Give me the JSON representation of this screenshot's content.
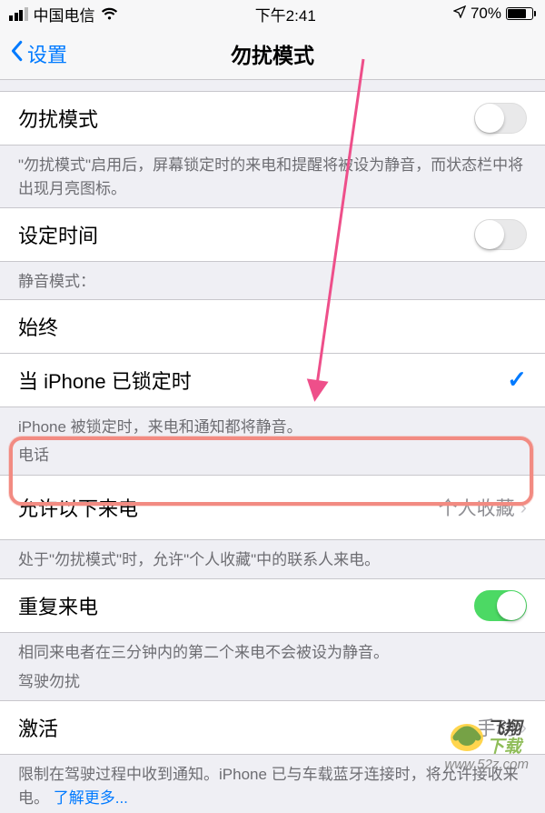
{
  "statusBar": {
    "carrier": "中国电信",
    "time": "下午2:41",
    "batteryPct": "70%"
  },
  "nav": {
    "back": "设置",
    "title": "勿扰模式"
  },
  "rows": {
    "dndLabel": "勿扰模式",
    "dndFooter": "\"勿扰模式\"启用后，屏幕锁定时的来电和提醒将被设为静音，而状态栏中将出现月亮图标。",
    "scheduledLabel": "设定时间",
    "silenceHeader": "静音模式：",
    "alwaysLabel": "始终",
    "lockedLabel": "当 iPhone 已锁定时",
    "lockedFooter": "iPhone 被锁定时，来电和通知都将静音。",
    "phoneHeader": "电话",
    "allowCallsLabel": "允许以下来电",
    "allowCallsValue": "个人收藏",
    "allowCallsFooter": "处于\"勿扰模式\"时，允许\"个人收藏\"中的联系人来电。",
    "repeatedLabel": "重复来电",
    "repeatedFooter1": "相同来电者在三分钟内的第二个来电不会被设为静音。",
    "drivingHeader": "驾驶勿扰",
    "activateLabel": "激活",
    "activateValue": "手动",
    "activateFooter": "限制在驾驶过程中收到通知。iPhone 已与车载蓝牙连接时，将允许接收来电。",
    "learnMore": "了解更多..."
  },
  "watermark": {
    "brand": "飞翔下载",
    "url": "www.52z.com"
  }
}
